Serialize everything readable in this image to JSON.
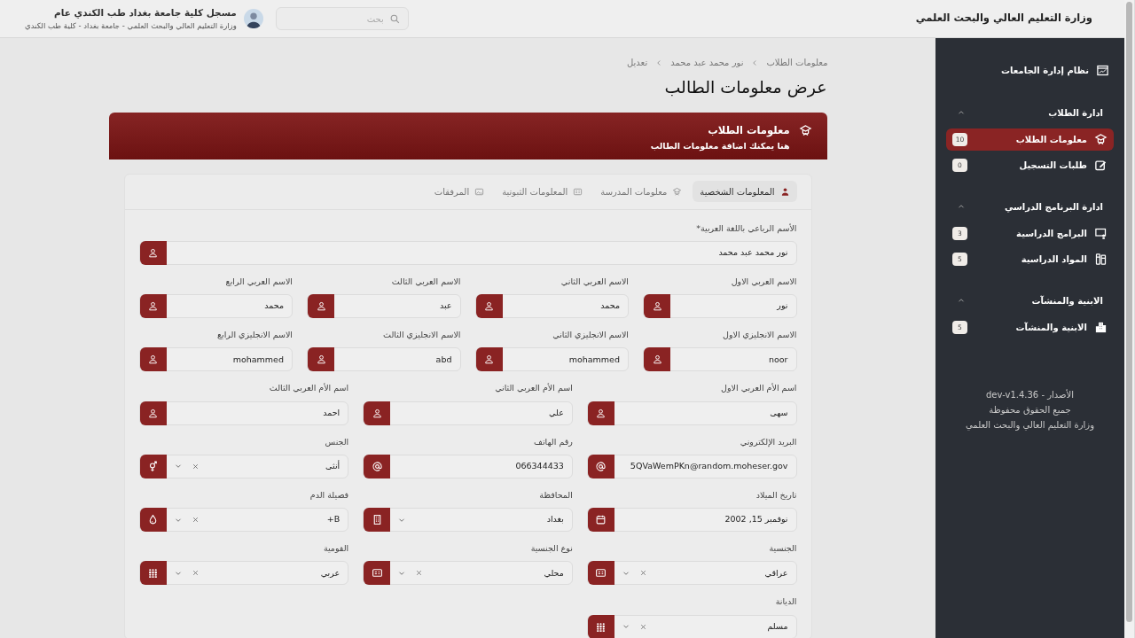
{
  "header": {
    "title": "وزارة التعليم العالي والبحث العلمي",
    "search": {
      "placeholder": "بحث"
    },
    "user": {
      "name": "مسجل كلية جامعة بغداد طب الكندي عام",
      "subtitle": "وزارة التعليم العالي والبحث العلمي - جامعة بغداد - كلية طب الكندي"
    }
  },
  "sidebar": {
    "brand": "نظام إدارة الجامعات",
    "sections": [
      {
        "title": "ادارة الطلاب",
        "expanded": true,
        "items": [
          {
            "label": "معلومات الطلاب",
            "badge": "10",
            "selected": true
          },
          {
            "label": "طلبات التسجيل",
            "badge": "0",
            "selected": false
          }
        ]
      },
      {
        "title": "ادارة البرنامج الدراسي",
        "expanded": true,
        "items": [
          {
            "label": "البرامج الدراسية",
            "badge": "3",
            "selected": false
          },
          {
            "label": "المواد الدراسية",
            "badge": "5",
            "selected": false
          }
        ]
      },
      {
        "title": "الابنية والمنشآت",
        "expanded": true,
        "items": [
          {
            "label": "الابنية والمنشآت",
            "badge": "5",
            "selected": false
          }
        ]
      }
    ],
    "footer": [
      "الأصدار - dev-v1.4.36",
      "جميع الحقوق محفوظة",
      "وزارة التعليم العالي والبحث العلمي"
    ]
  },
  "breadcrumb": [
    "معلومات الطلاب",
    "نور محمد عبد محمد",
    "تعديل"
  ],
  "page_title": "عرض معلومات الطالب",
  "banner": {
    "title": "معلومات الطلاب",
    "subtitle": "هنا يمكنك اضافة معلومات الطالب"
  },
  "tabs": [
    {
      "label": "المعلومات الشخصية",
      "selected": true
    },
    {
      "label": "معلومات المدرسة",
      "selected": false
    },
    {
      "label": "المعلومات الثبوتية",
      "selected": false
    },
    {
      "label": "المرفقات",
      "selected": false
    }
  ],
  "rows": [
    [
      {
        "label": "الأسم الرباعي باللغة العربية*",
        "value": "نور محمد عبد محمد",
        "kind": "text"
      }
    ],
    [
      {
        "label": "الاسم العربي الاول",
        "value": "نور",
        "kind": "text"
      },
      {
        "label": "الاسم العربي الثاني",
        "value": "محمد",
        "kind": "text"
      },
      {
        "label": "الاسم العربي الثالث",
        "value": "عبد",
        "kind": "text"
      },
      {
        "label": "الاسم العربي الرابع",
        "value": "محمد",
        "kind": "text"
      }
    ],
    [
      {
        "label": "الاسم الانجليزي الاول",
        "value": "noor",
        "kind": "text"
      },
      {
        "label": "الاسم الانجليزي الثاني",
        "value": "mohammed",
        "kind": "text"
      },
      {
        "label": "الاسم الانجليزي الثالث",
        "value": "abd",
        "kind": "text"
      },
      {
        "label": "الاسم الانجليزي الرابع",
        "value": "mohammed",
        "kind": "text"
      }
    ],
    [
      {
        "label": "اسم الأم العربي الاول",
        "value": "سهى",
        "kind": "text"
      },
      {
        "label": "اسم الأم العربي الثاني",
        "value": "علي",
        "kind": "text"
      },
      {
        "label": "اسم الأم العربي الثالث",
        "value": "احمد",
        "kind": "text"
      }
    ],
    [
      {
        "label": "البريد الإلكتروني",
        "value": "5QVaWemPKn@random.moheser.gov",
        "kind": "text"
      },
      {
        "label": "رقم الهاتف",
        "value": "066344433",
        "kind": "text"
      },
      {
        "label": "الجنس",
        "value": "أنثى",
        "kind": "select",
        "clearable": true
      }
    ],
    [
      {
        "label": "تاريخ الميلاد",
        "value": "نوفمبر 15, 2002",
        "kind": "text"
      },
      {
        "label": "المحافظة",
        "value": "بغداد",
        "kind": "select",
        "clearable": false
      },
      {
        "label": "فصيلة الدم",
        "value": "B+",
        "kind": "select",
        "clearable": true
      }
    ],
    [
      {
        "label": "الجنسية",
        "value": "عراقي",
        "kind": "select",
        "clearable": true
      },
      {
        "label": "نوع الجنسية",
        "value": "محلي",
        "kind": "select",
        "clearable": true
      },
      {
        "label": "القومية",
        "value": "عربي",
        "kind": "select",
        "clearable": true
      }
    ],
    [
      {
        "label": "الديانة",
        "value": "مسلم",
        "kind": "select",
        "clearable": true
      }
    ]
  ]
}
